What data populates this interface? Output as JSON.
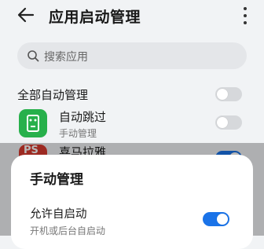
{
  "header": {
    "title": "应用启动管理",
    "back_icon": "arrow-left-icon",
    "more_icon": "more-vertical-icon"
  },
  "search": {
    "placeholder": "搜索应用",
    "icon": "search-icon"
  },
  "section": {
    "label": "全部自动管理",
    "toggle_on": false
  },
  "apps": [
    {
      "name": "自动跳过",
      "status": "手动管理",
      "toggle_on": false,
      "icon_color": "#27b04b"
    },
    {
      "name": "喜马拉雅",
      "icon_text": "PS",
      "toggle_on": true,
      "icon_color": "#d83a2f"
    }
  ],
  "sheet": {
    "title": "手动管理",
    "option_label": "允许自启动",
    "option_sub": "开机或后台自启动",
    "option_on": true
  },
  "colors": {
    "accent": "#1a73e8",
    "toggle_off": "#d6d8db",
    "background": "#f1f3f5"
  }
}
